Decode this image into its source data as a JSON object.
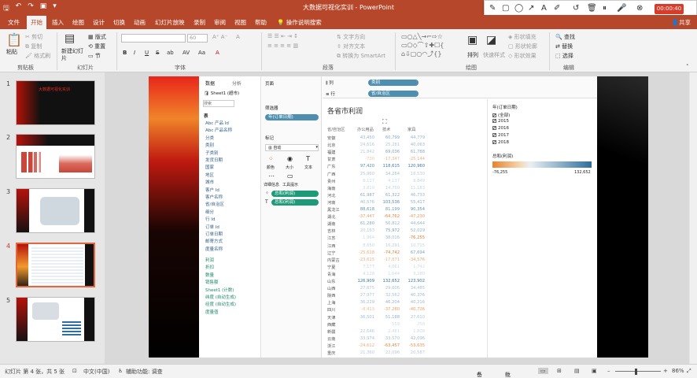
{
  "title": "大数据可视化实训 - PowerPoint",
  "quick_access": [
    "save-icon",
    "undo-icon",
    "redo-icon",
    "present-icon",
    "customize-icon"
  ],
  "window_controls": [
    "ribbon-display-icon",
    "minimize-icon",
    "restore-icon",
    "close-icon"
  ],
  "menu": {
    "tabs": [
      "文件",
      "开始",
      "插入",
      "绘图",
      "设计",
      "切换",
      "动画",
      "幻灯片放映",
      "录制",
      "审阅",
      "视图",
      "帮助"
    ],
    "active": "开始",
    "tell_me": "操作说明搜索",
    "share": "共享"
  },
  "ribbon": {
    "clipboard": {
      "paste": "粘贴",
      "cut": "剪切",
      "copy": "复制",
      "format_painter": "格式刷",
      "group": "剪贴板"
    },
    "slides": {
      "new_slide": "新建幻灯片",
      "layout": "版式",
      "reset": "重置",
      "section": "节",
      "group": "幻灯片"
    },
    "font": {
      "name": "",
      "size": "60",
      "bold": "B",
      "italic": "I",
      "underline": "U",
      "strike": "S",
      "shadow": "ab",
      "spacing": "AV",
      "case": "Aa",
      "color": "A",
      "clear": "A",
      "group": "字体"
    },
    "paragraph": {
      "text_direction": "文字方向",
      "align_text": "对齐文本",
      "smartart": "转换为 SmartArt",
      "group": "段落"
    },
    "drawing": {
      "arrange": "排列",
      "quick_styles": "快速样式",
      "shape_fill": "形状填充",
      "shape_outline": "形状轮廓",
      "shape_effects": "形状效果",
      "group": "绘图"
    },
    "editing": {
      "find": "查找",
      "replace": "替换",
      "select": "选择",
      "group": "编辑"
    }
  },
  "recording_bar": {
    "tools": [
      "pen-icon",
      "rectangle-icon",
      "circle-icon",
      "arrow-icon",
      "text-icon",
      "highlighter-icon",
      "undo-icon",
      "delete-icon",
      "pause-icon",
      "mic-icon",
      "stop-icon"
    ],
    "timer": "00:00:40 录制"
  },
  "slides": [
    {
      "num": "1",
      "title": "大数据可视化实训"
    },
    {
      "num": "2"
    },
    {
      "num": "3"
    },
    {
      "num": "4",
      "selected": true
    },
    {
      "num": "5"
    }
  ],
  "tableau": {
    "tabs": [
      "数据",
      "分析"
    ],
    "datasource": "Sheet1 (超市)",
    "search_placeholder": "搜索",
    "section_table": "表",
    "dimensions": [
      "Abc 产品 Id",
      "Abc 产品名称",
      "分类",
      "类别",
      "子类别",
      "发货日期",
      "国家",
      "地区",
      "城市",
      "客户 Id",
      "客户名称",
      "省/自治区",
      "细分",
      "行 Id",
      "订单 Id",
      "订单日期",
      "邮寄方式",
      "度量名称"
    ],
    "measures": [
      "利润",
      "折扣",
      "数量",
      "销售额",
      "Sheet1 (计数)",
      "纬度 (自动生成)",
      "经度 (自动生成)",
      "度量值"
    ],
    "pages_label": "页面",
    "filters_label": "筛选器",
    "filter_pill": "年(订单日期)",
    "marks_label": "标记",
    "marks_type": "自动",
    "marks_buttons": [
      "颜色",
      "大小",
      "文本",
      "详细信息",
      "工具提示"
    ],
    "marks_pills": [
      "总和(利润)",
      "总和(利润)"
    ],
    "columns_label": "列",
    "columns_pill": "类别",
    "rows_label": "行",
    "rows_pill": "省/自治区",
    "sheet_title": "各省市利润",
    "col_headers": [
      "省/自治区",
      "办公用品",
      "技术",
      "家具"
    ],
    "rows": [
      [
        "安徽",
        "43,450",
        "60,799",
        "44,779"
      ],
      [
        "北京",
        "24,616",
        "25,281",
        "40,063"
      ],
      [
        "福建",
        "21,842",
        "69,036",
        "61,788"
      ],
      [
        "甘肃",
        "-730",
        "-17,347",
        "-25,144"
      ],
      [
        "广东",
        "97,420",
        "118,615",
        "120,960"
      ],
      [
        "广西",
        "25,960",
        "34,264",
        "18,530"
      ],
      [
        "贵州",
        "6,117",
        "4,137",
        "9,849"
      ],
      [
        "海南",
        "3,819",
        "14,750",
        "11,183"
      ],
      [
        "河北",
        "61,987",
        "61,322",
        "46,733"
      ],
      [
        "河南",
        "40,576",
        "103,536",
        "55,417"
      ],
      [
        "黑龙江",
        "88,618",
        "81,199",
        "90,354"
      ],
      [
        "湖北",
        "-37,447",
        "-64,762",
        "-47,230"
      ],
      [
        "湖南",
        "61,280",
        "50,812",
        "44,644"
      ],
      [
        "吉林",
        "20,163",
        "75,972",
        "52,029"
      ],
      [
        "江苏",
        "1,964",
        "38,016",
        "-76,255"
      ],
      [
        "江西",
        "8,650",
        "16,291",
        "10,715"
      ],
      [
        "辽宁",
        "-25,618",
        "-74,742",
        "67,694"
      ],
      [
        "内蒙古",
        "-23,615",
        "-17,871",
        "-34,576"
      ],
      [
        "宁夏",
        "7,177",
        "4,061",
        "1,742"
      ],
      [
        "青海",
        "4,128",
        "1,644",
        "3,280"
      ],
      [
        "山东",
        "126,909",
        "132,652",
        "123,902"
      ],
      [
        "山西",
        "27,675",
        "29,606",
        "34,485"
      ],
      [
        "陕西",
        "27,977",
        "32,562",
        "40,376"
      ],
      [
        "上海",
        "36,229",
        "46,204",
        "40,216"
      ],
      [
        "四川",
        "-8,413",
        "-37,280",
        "-40,726"
      ],
      [
        "天津",
        "36,501",
        "51,188",
        "27,610"
      ],
      [
        "西藏",
        "",
        "559",
        "258"
      ],
      [
        "新疆",
        "22,646",
        "2,481",
        "1,808"
      ],
      [
        "云南",
        "33,974",
        "33,570",
        "42,096"
      ],
      [
        "浙江",
        "-24,612",
        "-63,457",
        "-53,635"
      ],
      [
        "重庆",
        "21,360",
        "22,096",
        "20,587"
      ]
    ],
    "year_filter_title": "年(订单日期)",
    "years": [
      "(全部)",
      "2015",
      "2016",
      "2017",
      "2018"
    ],
    "legend_title": "总和(利润)",
    "legend_min": "-76,255",
    "legend_max": "132,652"
  },
  "status": {
    "slide_info": "幻灯片 第 4 张，共 5 张",
    "language": "中文(中国)",
    "accessibility": "辅助功能: 调查",
    "notes": "备注",
    "comments": "批注",
    "zoom": "86%"
  },
  "colors": {
    "accent": "#b7472a",
    "tableau_pill_blue": "#4e8fb1",
    "tableau_pill_green": "#1e9a79",
    "positive": "#2f6e9c",
    "negative": "#e07b2f"
  }
}
